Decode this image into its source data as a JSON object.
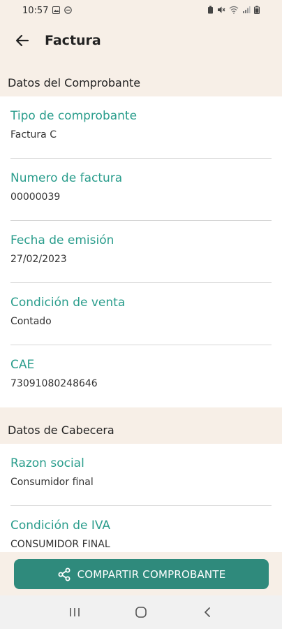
{
  "status_bar": {
    "time": "10:57",
    "left_icons": [
      "image-icon",
      "do-not-disturb-icon"
    ],
    "right_icons": [
      "battery-saver-icon",
      "mute-icon",
      "wifi-icon",
      "signal-icon",
      "battery-icon"
    ]
  },
  "app_bar": {
    "title": "Factura"
  },
  "sections": [
    {
      "title": "Datos del Comprobante",
      "fields": [
        {
          "label": "Tipo de comprobante",
          "value": "Factura C"
        },
        {
          "label": "Numero de factura",
          "value": "00000039"
        },
        {
          "label": "Fecha de emisión",
          "value": "27/02/2023"
        },
        {
          "label": "Condición de venta",
          "value": "Contado"
        },
        {
          "label": "CAE",
          "value": "73091080248646"
        }
      ]
    },
    {
      "title": "Datos de Cabecera",
      "fields": [
        {
          "label": "Razon social",
          "value": "Consumidor final"
        },
        {
          "label": "Condición de IVA",
          "value": "CONSUMIDOR FINAL"
        }
      ]
    }
  ],
  "share_button": {
    "label": "COMPARTIR COMPROBANTE",
    "icon": "share-icon"
  },
  "colors": {
    "accent": "#2a9d8c",
    "button": "#2f8a7c",
    "background": "#f7efe7"
  }
}
